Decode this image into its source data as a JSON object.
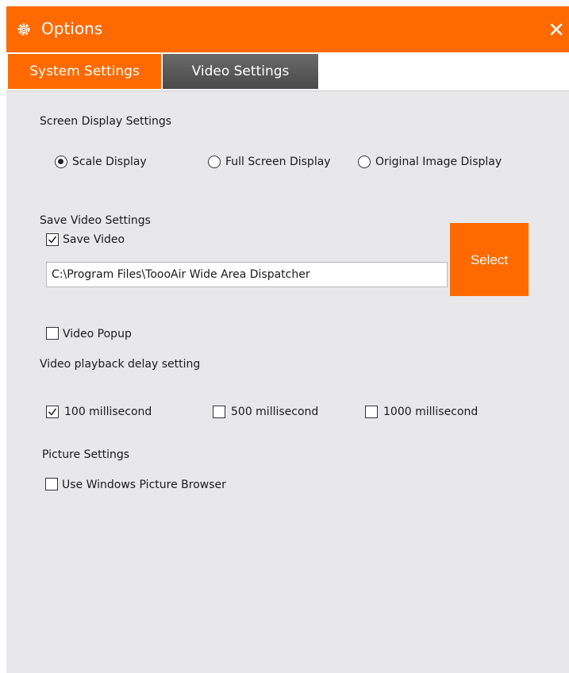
{
  "window": {
    "title": "Options",
    "title_icon": "gear-icon",
    "close_icon": "close-icon"
  },
  "tabs": [
    {
      "label": "System Settings",
      "active": true
    },
    {
      "label": "Video Settings",
      "active": false
    }
  ],
  "screen_display": {
    "heading": "Screen Display Settings",
    "options": [
      {
        "label": "Scale Display",
        "selected": true
      },
      {
        "label": "Full Screen Display",
        "selected": false
      },
      {
        "label": "Original Image Display",
        "selected": false
      }
    ]
  },
  "save_video": {
    "heading": "Save Video Settings",
    "save_label": "Save Video",
    "save_checked": true,
    "path_value": "C:\\Program Files\\ToooAir Wide Area Dispatcher",
    "select_label": "Select"
  },
  "video_popup": {
    "label": "Video Popup",
    "checked": false
  },
  "playback_delay": {
    "heading": "Video playback delay setting",
    "options": [
      {
        "label": "100 millisecond",
        "checked": true
      },
      {
        "label": "500 millisecond",
        "checked": false
      },
      {
        "label": "1000 millisecond",
        "checked": false
      }
    ]
  },
  "picture": {
    "heading": "Picture Settings",
    "browser_label": "Use Windows Picture Browser",
    "browser_checked": false
  },
  "colors": {
    "accent": "#ff6a00",
    "tab_inactive": "#555555",
    "panel": "#e8e8ea"
  }
}
